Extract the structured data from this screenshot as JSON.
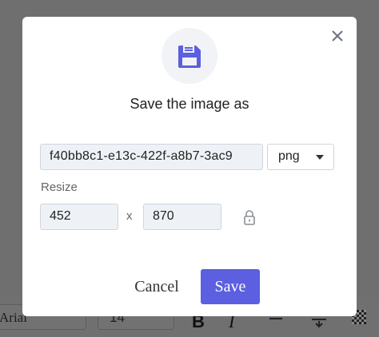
{
  "background_toolbar": {
    "font_select_value": "Arial",
    "size_select_value": "14"
  },
  "dialog": {
    "title": "Save the image as",
    "icon": "floppy-disk-icon",
    "accent_color": "#5b5fe0",
    "filename": {
      "value": "f40bb8c1-e13c-422f-a8b7-3ac9"
    },
    "format": {
      "selected": "png"
    },
    "resize": {
      "label": "Resize",
      "width": "452",
      "separator": "x",
      "height": "870",
      "lock_icon": "lock-icon"
    },
    "buttons": {
      "cancel": "Cancel",
      "save": "Save"
    }
  }
}
